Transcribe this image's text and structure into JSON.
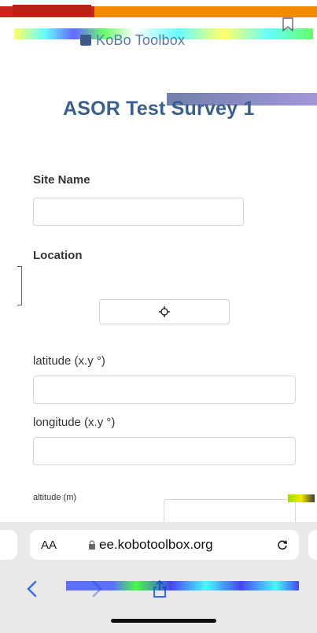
{
  "browser": {
    "brand_text": "KoBo Toolbox",
    "aa_label": "AA",
    "url_text": "ee.kobotoolbox.org",
    "colors": {
      "safari_bar": "#e9e9ea",
      "accent": "#3a5f8c"
    }
  },
  "survey": {
    "title": "ASOR Test Survey 1",
    "fields": {
      "site_name_label": "Site Name",
      "location_label": "Location",
      "latitude_label": "latitude (x.y °)",
      "longitude_label": "longitude (x.y °)",
      "altitude_label": "altitude (m)"
    }
  },
  "icons": {
    "bookmark": "bookmark-icon",
    "target": "crosshair-target-icon",
    "lock": "lock-icon",
    "reload": "reload-icon",
    "back": "chevron-left-icon",
    "forward": "chevron-right-icon",
    "share": "share-icon"
  }
}
